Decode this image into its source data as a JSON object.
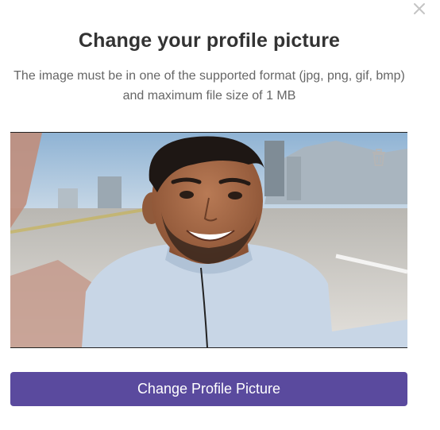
{
  "dialog": {
    "title": "Change your profile picture",
    "subtitle": "The image must be in one of the supported format (jpg, png, gif, bmp) and maximum file size of 1 MB",
    "primary_button_label": "Change Profile Picture",
    "close_icon": "close-icon",
    "delete_icon": "trash-icon"
  },
  "colors": {
    "primary": "#5a4a9e",
    "title": "#333333",
    "text": "#666666",
    "icon": "#bbbbbb"
  }
}
